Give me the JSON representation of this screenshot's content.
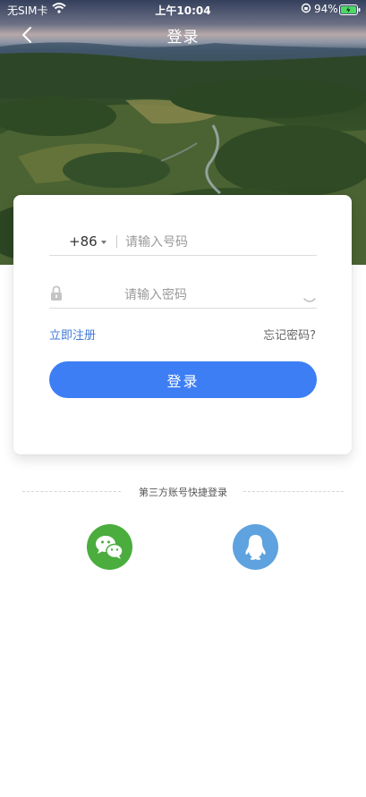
{
  "status_bar": {
    "carrier": "无SIM卡",
    "time": "上午10:04",
    "battery": "94%"
  },
  "nav": {
    "title": "登录"
  },
  "login_form": {
    "country_code": "+86",
    "phone_placeholder": "请输入号码",
    "password_placeholder": "请输入密码",
    "register_label": "立即注册",
    "forgot_label": "忘记密码?",
    "login_button_label": "登录"
  },
  "third_party": {
    "title": "第三方账号快捷登录",
    "providers": [
      "wechat-icon",
      "qq-icon"
    ]
  },
  "colors": {
    "primary": "#3d7ef4",
    "link": "#3f7ad8",
    "wechat": "#4aad3e",
    "qq": "#5ea2df"
  }
}
